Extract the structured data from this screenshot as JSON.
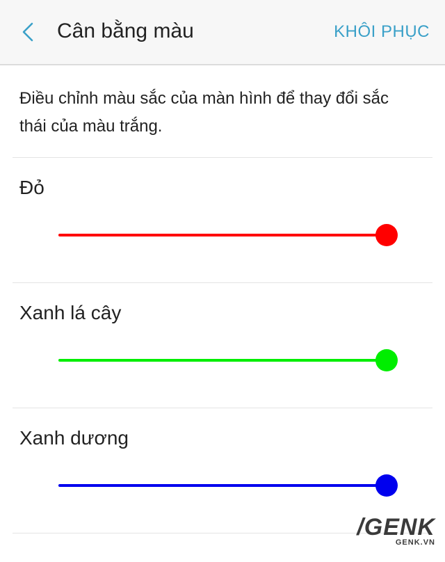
{
  "header": {
    "title": "Cân bằng màu",
    "reset_label": "KHÔI PHỤC",
    "back_icon": "chevron-left-icon"
  },
  "description": "Điều chỉnh màu sắc của màn hình để thay đổi sắc thái của màu trắng.",
  "sliders": [
    {
      "label": "Đỏ",
      "color": "#ff0000",
      "value": 1.0
    },
    {
      "label": "Xanh lá cây",
      "color": "#00ee00",
      "value": 1.0
    },
    {
      "label": "Xanh dương",
      "color": "#0000ee",
      "value": 1.0
    }
  ],
  "colors": {
    "accent": "#3aa0c8",
    "header_bg": "#f7f7f7"
  },
  "watermark": {
    "logo": "/GENK",
    "site": "GENK.VN"
  }
}
